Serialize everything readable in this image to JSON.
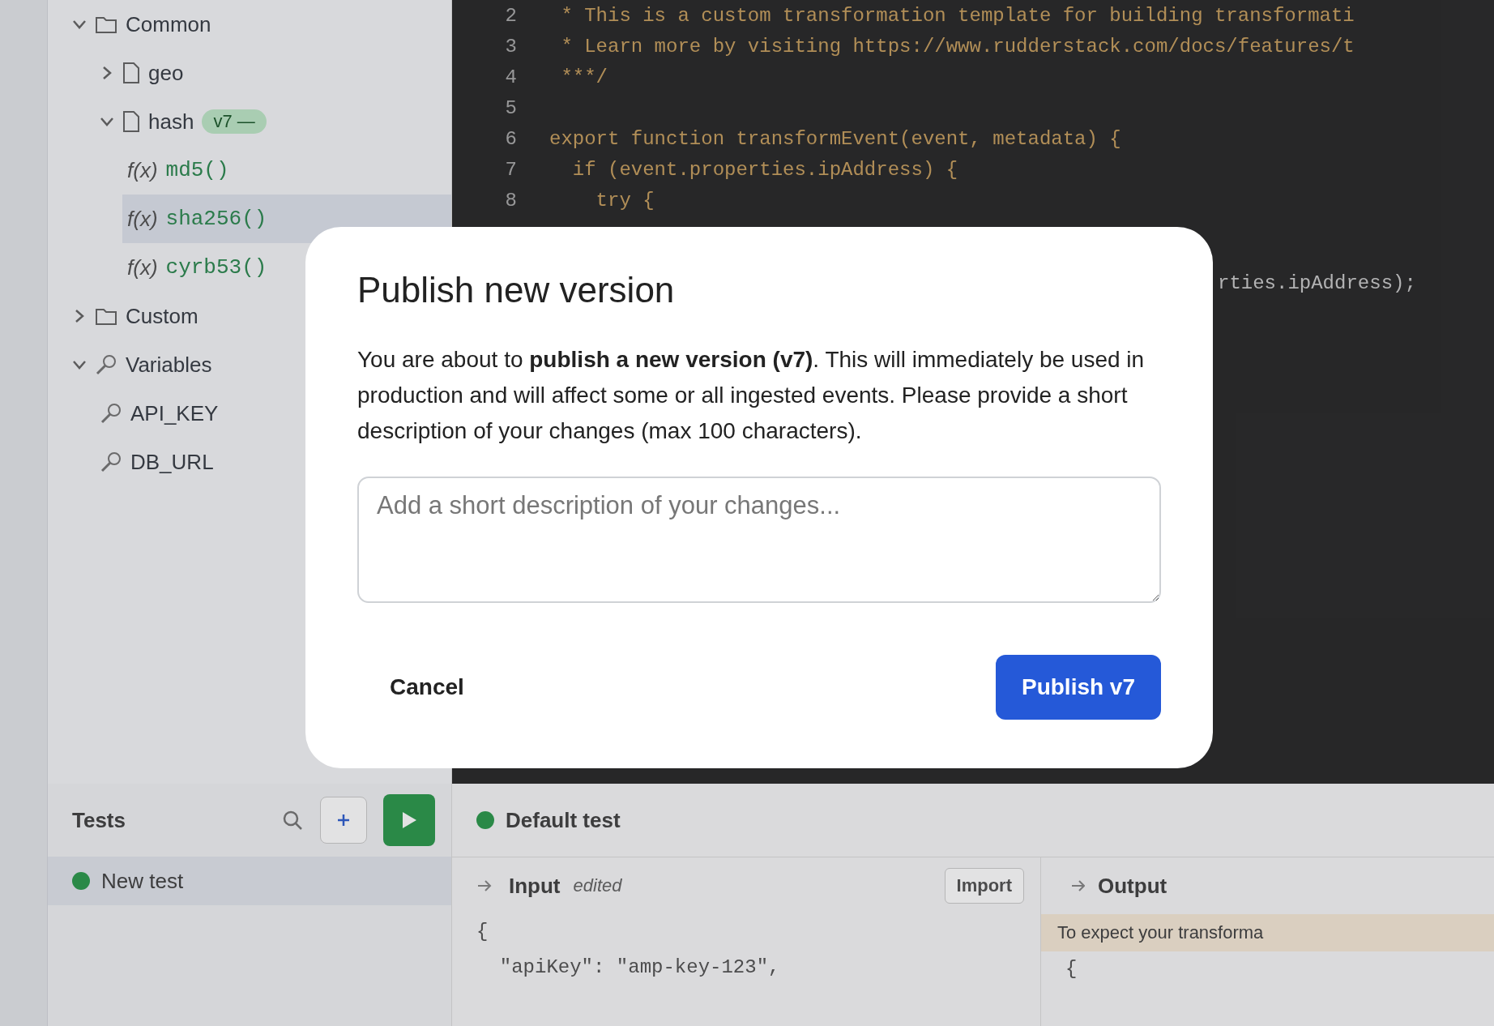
{
  "background": {
    "tree": [
      {
        "label": "Common",
        "kind": "folder",
        "expanded": true,
        "children": [
          {
            "label": "geo",
            "kind": "file",
            "expanded": false
          },
          {
            "label": "hash",
            "kind": "file",
            "expanded": true,
            "badge": "v7 —",
            "children": [
              {
                "label": "md5()",
                "kind": "function",
                "icon_text": "f(x)",
                "selected": false
              },
              {
                "label": "sha256()",
                "kind": "function",
                "icon_text": "f(x)",
                "selected": true
              },
              {
                "label": "cyrb53()",
                "kind": "function",
                "icon_text": "f(x)",
                "selected": false
              }
            ]
          }
        ]
      },
      {
        "label": "Custom",
        "kind": "folder",
        "expanded": false
      },
      {
        "label": "Variables",
        "kind": "variables",
        "expanded": true,
        "children": [
          {
            "label": "API_KEY",
            "kind": "variable"
          },
          {
            "label": "DB_URL",
            "kind": "variable"
          }
        ]
      }
    ],
    "code": [
      {
        "num": "2",
        "text": " * This is a custom transformation template for building transformati"
      },
      {
        "num": "3",
        "text": " * Learn more by visiting https://www.rudderstack.com/docs/features/t"
      },
      {
        "num": "4",
        "text": " ***/"
      },
      {
        "num": "5"
      },
      {
        "num": "6",
        "text": "export function transformEvent(event, metadata) {"
      },
      {
        "num": "7",
        "text": "  if (event.properties.ipAddress) {"
      },
      {
        "num": "8",
        "text": "    try {"
      }
    ],
    "code_fragment": "rties.ipAddress);",
    "tests": {
      "title": "Tests",
      "items": [
        {
          "label": "New test",
          "selected": true
        }
      ]
    },
    "test_detail": {
      "title": "Default test",
      "input_label": "Input",
      "input_state": "edited",
      "import_button": "Import",
      "output_label": "Output",
      "input_lines": [
        "{",
        "  \"apiKey\": \"amp-key-123\","
      ],
      "output_note": "To expect your transforma",
      "output_lines": [
        "{"
      ]
    }
  },
  "dialog": {
    "title": "Publish new version",
    "message": "You are about to **publish a new version (v7)**. This will immediately be used in production and will affect some or all ingested events. Please provide a short description of your changes (max 100 characters).",
    "description_field": {
      "placeholder": "Add a short description of your changes..."
    },
    "cancel_button": "Cancel",
    "publish_button": "Publish v7"
  }
}
